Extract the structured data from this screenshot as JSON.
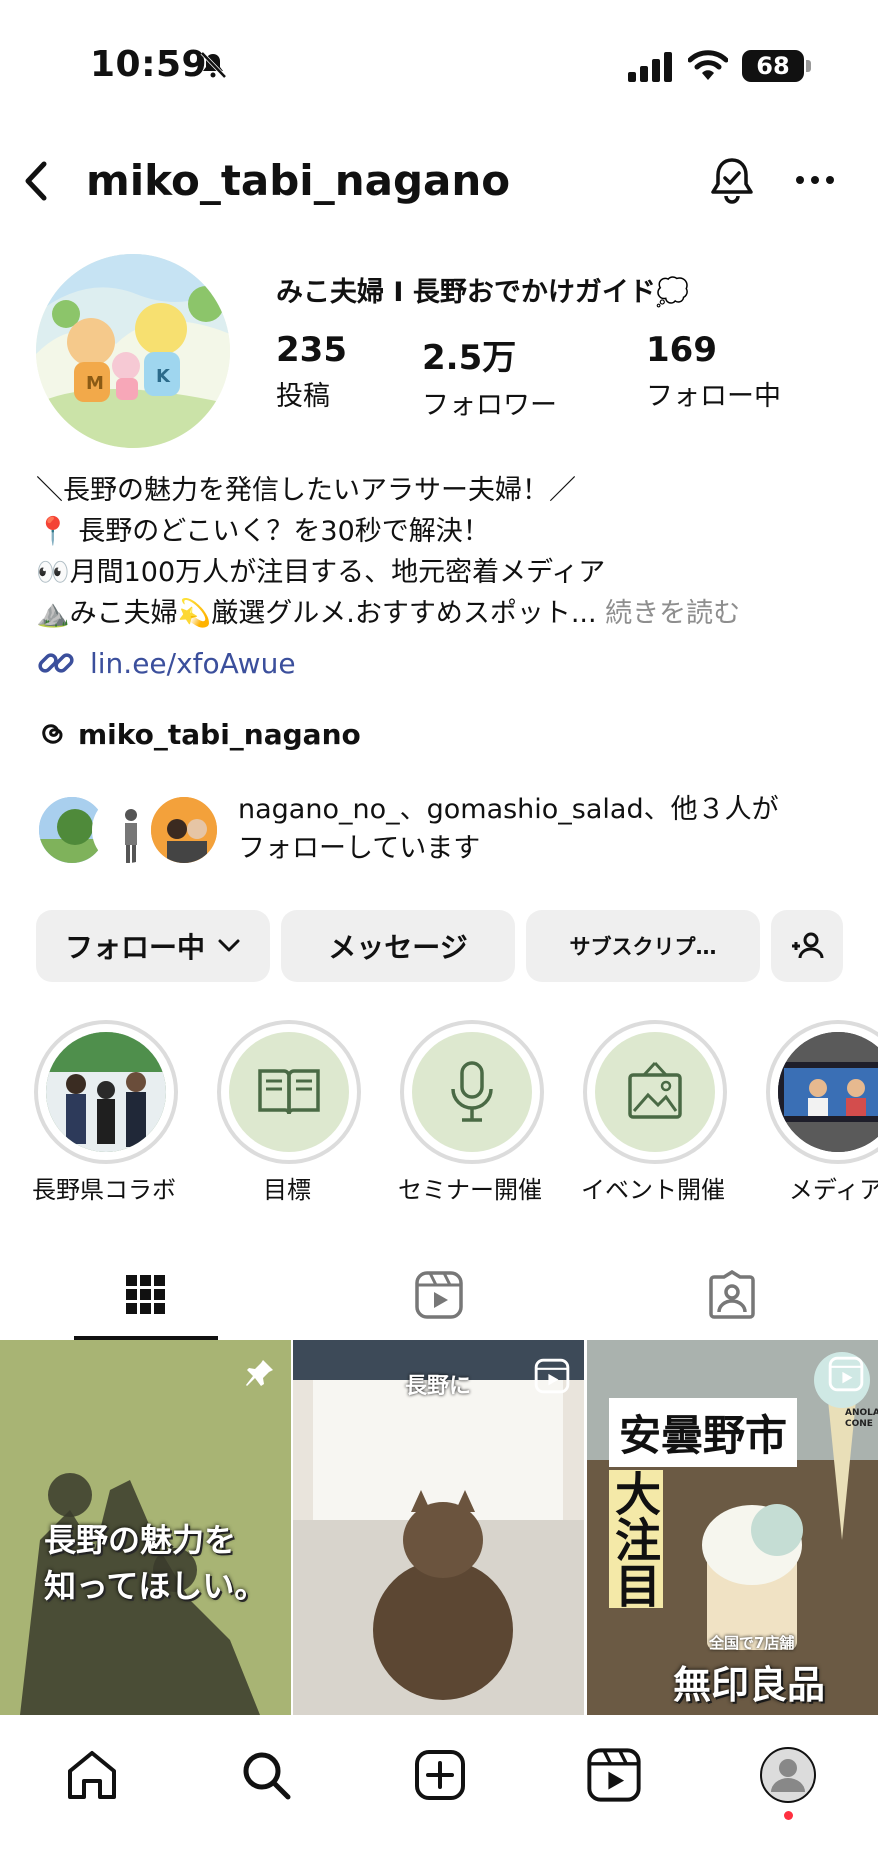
{
  "status_bar": {
    "time": "10:59",
    "battery": "68"
  },
  "header": {
    "username": "miko_tabi_nagano"
  },
  "profile": {
    "display_name": "みこ夫婦 I 長野おでかけガイド💭",
    "stats": [
      {
        "value": "235",
        "label": "投稿"
      },
      {
        "value": "2.5万",
        "label": "フォロワー"
      },
      {
        "value": "169",
        "label": "フォロー中"
      }
    ],
    "bio": [
      "＼長野の魅力を発信したいアラサー夫婦！／",
      "📍 長野のどこいく？を30秒で解決！",
      "👀月間100万人が注目する、地元密着メディア",
      "⛰️みこ夫婦💫厳選グルメ.おすすめスポット..."
    ],
    "read_more": "続きを読む",
    "link": "lin.ee/xfoAwue",
    "threads_handle": "miko_tabi_nagano",
    "followed_by_line1": "nagano_no_、gomashio_salad、他３人が",
    "followed_by_line2": "フォローしています"
  },
  "actions": {
    "following": "フォロー中",
    "message": "メッセージ",
    "subscribe": "サブスクリプ…"
  },
  "highlights": [
    {
      "label": "長野県コラボ"
    },
    {
      "label": "目標"
    },
    {
      "label": "セミナー開催"
    },
    {
      "label": "イベント開催"
    },
    {
      "label": "メディア"
    }
  ],
  "grid": {
    "tile1_line1": "長野の魅力を",
    "tile1_line2": "知ってほしい。",
    "tile2_caption": "長野に",
    "tile3_title": "安曇野市",
    "tile3_vertical": "大注目",
    "tile3_sub": "全国で7店舗",
    "tile3_brand": "無印良品",
    "tile3_cone": "ANOLA CONE"
  },
  "colors": {
    "link": "#3b4f9c",
    "button_bg": "#efefef",
    "highlight_green": "#dde8cf",
    "notification": "#ff3040"
  }
}
